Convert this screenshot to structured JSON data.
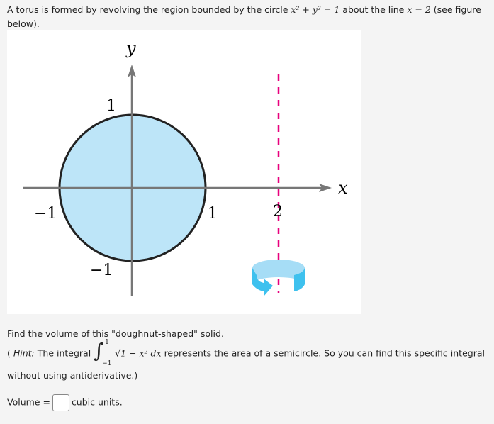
{
  "intro": {
    "text1": "A torus is formed by revolving the region bounded by the circle ",
    "eq1": "x² + y² = 1",
    "text2": " about the line ",
    "eq2": "x = 2",
    "text3": " (see figure",
    "text4": "below)."
  },
  "figure": {
    "y_label": "y",
    "x_label": "x",
    "tick_y_pos": "1",
    "tick_y_neg": "−1",
    "tick_x_neg": "−1",
    "tick_x_pos": "1",
    "tick_axis": "2",
    "colors": {
      "disk": "#bde5f8",
      "axis_line": "#e8007d",
      "arrow": "#3ec1ee"
    }
  },
  "question": "Find the volume of this \"doughnut-shaped\" solid.",
  "hint": {
    "open": "( ",
    "hint_word": "Hint:",
    "text1": " The integral ",
    "upper": "1",
    "lower": "−1",
    "integrand": "√1 − x² dx",
    "text2": " represents the area of a semicircle. So you can find this specific integral",
    "text3": "without using antiderivative.)"
  },
  "answer": {
    "label": "Volume =",
    "value": "",
    "suffix": "cubic units."
  }
}
